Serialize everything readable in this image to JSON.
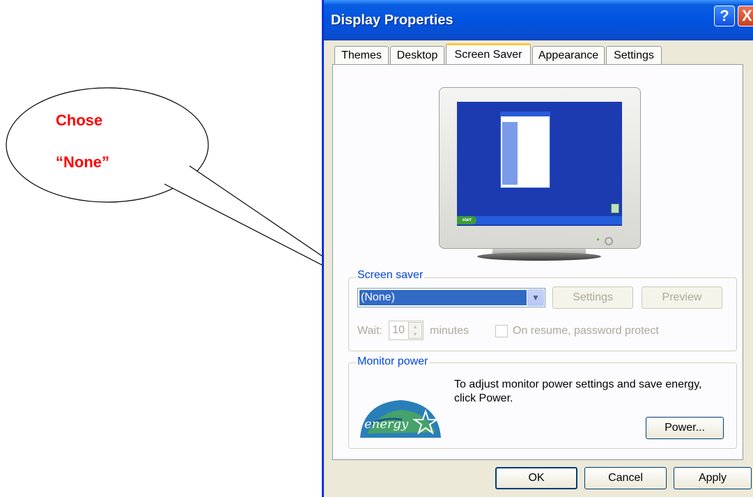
{
  "callout": {
    "line1": "Chose",
    "line2": "“None”",
    "color": "#ff0000"
  },
  "window": {
    "title": "Display Properties",
    "help_glyph": "?",
    "close_glyph": "X"
  },
  "tabs": [
    {
      "label": "Themes"
    },
    {
      "label": "Desktop"
    },
    {
      "label": "Screen Saver",
      "active": true
    },
    {
      "label": "Appearance"
    },
    {
      "label": "Settings"
    }
  ],
  "preview": {
    "start_label": "start"
  },
  "screen_saver": {
    "group_label": "Screen saver",
    "selected": "(None)",
    "settings_button": "Settings",
    "preview_button": "Preview",
    "wait_label": "Wait:",
    "wait_value": "10",
    "minutes_label": "minutes",
    "password_label": "On resume, password protect"
  },
  "monitor_power": {
    "group_label": "Monitor power",
    "description": "To adjust monitor power settings and save energy, click Power.",
    "logo_text": "energy",
    "power_button": "Power..."
  },
  "footer": {
    "ok": "OK",
    "cancel": "Cancel",
    "apply": "Apply"
  }
}
